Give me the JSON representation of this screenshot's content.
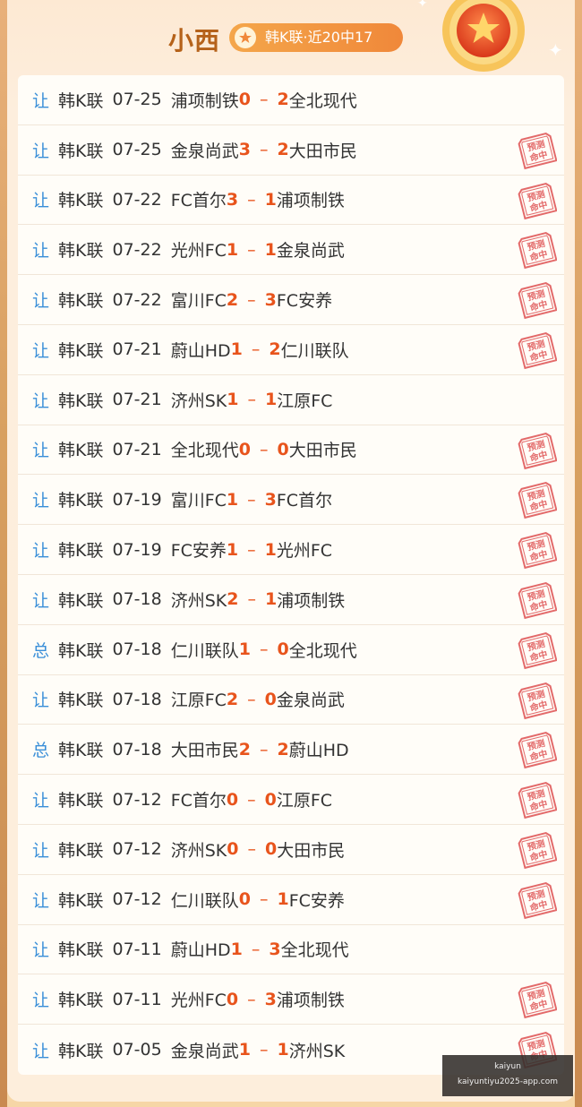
{
  "header": {
    "name": "小西",
    "badge_text": "韩K联·近20中17"
  },
  "matches": [
    {
      "type": "让",
      "league": "韩K联",
      "date": "07-25",
      "home": "浦项制铁",
      "home_score": "0",
      "away_score": "2",
      "away": "全北现代",
      "hit": false
    },
    {
      "type": "让",
      "league": "韩K联",
      "date": "07-25",
      "home": "金泉尚武",
      "home_score": "3",
      "away_score": "2",
      "away": "大田市民",
      "hit": true
    },
    {
      "type": "让",
      "league": "韩K联",
      "date": "07-22",
      "home": "FC首尔",
      "home_score": "3",
      "away_score": "1",
      "away": "浦项制铁",
      "hit": true
    },
    {
      "type": "让",
      "league": "韩K联",
      "date": "07-22",
      "home": "光州FC",
      "home_score": "1",
      "away_score": "1",
      "away": "金泉尚武",
      "hit": true
    },
    {
      "type": "让",
      "league": "韩K联",
      "date": "07-22",
      "home": "富川FC",
      "home_score": "2",
      "away_score": "3",
      "away": "FC安养",
      "hit": true
    },
    {
      "type": "让",
      "league": "韩K联",
      "date": "07-21",
      "home": "蔚山HD",
      "home_score": "1",
      "away_score": "2",
      "away": "仁川联队",
      "hit": true
    },
    {
      "type": "让",
      "league": "韩K联",
      "date": "07-21",
      "home": "济州SK",
      "home_score": "1",
      "away_score": "1",
      "away": "江原FC",
      "hit": false
    },
    {
      "type": "让",
      "league": "韩K联",
      "date": "07-21",
      "home": "全北现代",
      "home_score": "0",
      "away_score": "0",
      "away": "大田市民",
      "hit": true
    },
    {
      "type": "让",
      "league": "韩K联",
      "date": "07-19",
      "home": "富川FC",
      "home_score": "1",
      "away_score": "3",
      "away": "FC首尔",
      "hit": true
    },
    {
      "type": "让",
      "league": "韩K联",
      "date": "07-19",
      "home": "FC安养",
      "home_score": "1",
      "away_score": "1",
      "away": "光州FC",
      "hit": true
    },
    {
      "type": "让",
      "league": "韩K联",
      "date": "07-18",
      "home": "济州SK",
      "home_score": "2",
      "away_score": "1",
      "away": "浦项制铁",
      "hit": true
    },
    {
      "type": "总",
      "league": "韩K联",
      "date": "07-18",
      "home": "仁川联队",
      "home_score": "1",
      "away_score": "0",
      "away": "全北现代",
      "hit": true
    },
    {
      "type": "让",
      "league": "韩K联",
      "date": "07-18",
      "home": "江原FC",
      "home_score": "2",
      "away_score": "0",
      "away": "金泉尚武",
      "hit": true
    },
    {
      "type": "总",
      "league": "韩K联",
      "date": "07-18",
      "home": "大田市民",
      "home_score": "2",
      "away_score": "2",
      "away": "蔚山HD",
      "hit": true
    },
    {
      "type": "让",
      "league": "韩K联",
      "date": "07-12",
      "home": "FC首尔",
      "home_score": "0",
      "away_score": "0",
      "away": "江原FC",
      "hit": true
    },
    {
      "type": "让",
      "league": "韩K联",
      "date": "07-12",
      "home": "济州SK",
      "home_score": "0",
      "away_score": "0",
      "away": "大田市民",
      "hit": true
    },
    {
      "type": "让",
      "league": "韩K联",
      "date": "07-12",
      "home": "仁川联队",
      "home_score": "0",
      "away_score": "1",
      "away": "FC安养",
      "hit": true
    },
    {
      "type": "让",
      "league": "韩K联",
      "date": "07-11",
      "home": "蔚山HD",
      "home_score": "1",
      "away_score": "3",
      "away": "全北现代",
      "hit": false
    },
    {
      "type": "让",
      "league": "韩K联",
      "date": "07-11",
      "home": "光州FC",
      "home_score": "0",
      "away_score": "3",
      "away": "浦项制铁",
      "hit": true
    },
    {
      "type": "让",
      "league": "韩K联",
      "date": "07-05",
      "home": "金泉尚武",
      "home_score": "1",
      "away_score": "1",
      "away": "济州SK",
      "hit": true
    }
  ],
  "stamp_text": "预测命中",
  "watermark": {
    "line1": "kaiyun",
    "line2": "kaiyuntiyu2025-app.com"
  },
  "colors": {
    "type_blue": "#3a8fd8",
    "score_orange": "#e8541c",
    "title_brown": "#b5621a",
    "stamp_red": "#e36a6a"
  }
}
